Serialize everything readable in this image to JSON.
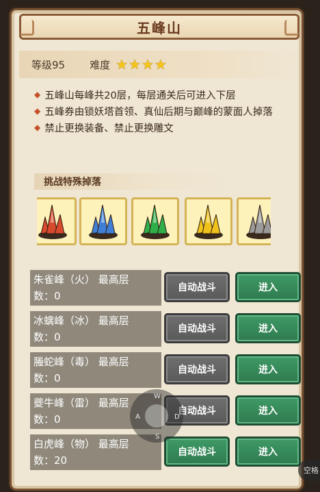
{
  "title": "五峰山",
  "level_text": "等级95",
  "difficulty_label": "难度",
  "difficulty_stars": 4,
  "rules": [
    "五峰山每峰共20层，每层通关后可进入下层",
    "五峰券由锁妖塔首领、真仙后期与巅峰的蒙面人掉落",
    "禁止更换装备、禁止更换雕文"
  ],
  "drop_title": "挑战特殊掉落",
  "drops": [
    {
      "icon": "red-crystal-icon",
      "color": "#d84a2e"
    },
    {
      "icon": "blue-crystal-icon",
      "color": "#3f7fd6"
    },
    {
      "icon": "green-crystal-icon",
      "color": "#2fae4a"
    },
    {
      "icon": "yellow-crystal-icon",
      "color": "#f0c21c"
    },
    {
      "icon": "grey-crystal-icon",
      "color": "#9a9a9a"
    }
  ],
  "peaks": [
    {
      "line1": "朱雀峰（火）  最高层",
      "line2": "数：0",
      "auto_label": "自动战斗",
      "enter_label": "进入",
      "auto_active": false
    },
    {
      "line1": "冰螭峰（冰）  最高层",
      "line2": "数：0",
      "auto_label": "自动战斗",
      "enter_label": "进入",
      "auto_active": false
    },
    {
      "line1": "螣蛇峰（毒）  最高层",
      "line2": "数：0",
      "auto_label": "自动战斗",
      "enter_label": "进入",
      "auto_active": false
    },
    {
      "line1": "夔牛峰（雷）  最高层",
      "line2": "数：0",
      "auto_label": "自动战斗",
      "enter_label": "进入",
      "auto_active": false
    },
    {
      "line1": "白虎峰（物）  最高层",
      "line2": "数：20",
      "auto_label": "自动战斗",
      "enter_label": "进入",
      "auto_active": true
    }
  ],
  "overlay": {
    "keys": [
      "W",
      "A",
      "D",
      "S"
    ],
    "space_label": "空格"
  },
  "colors": {
    "accent_green": "#2f7a4f",
    "star": "#f6c517",
    "panel": "#efe6d3"
  }
}
